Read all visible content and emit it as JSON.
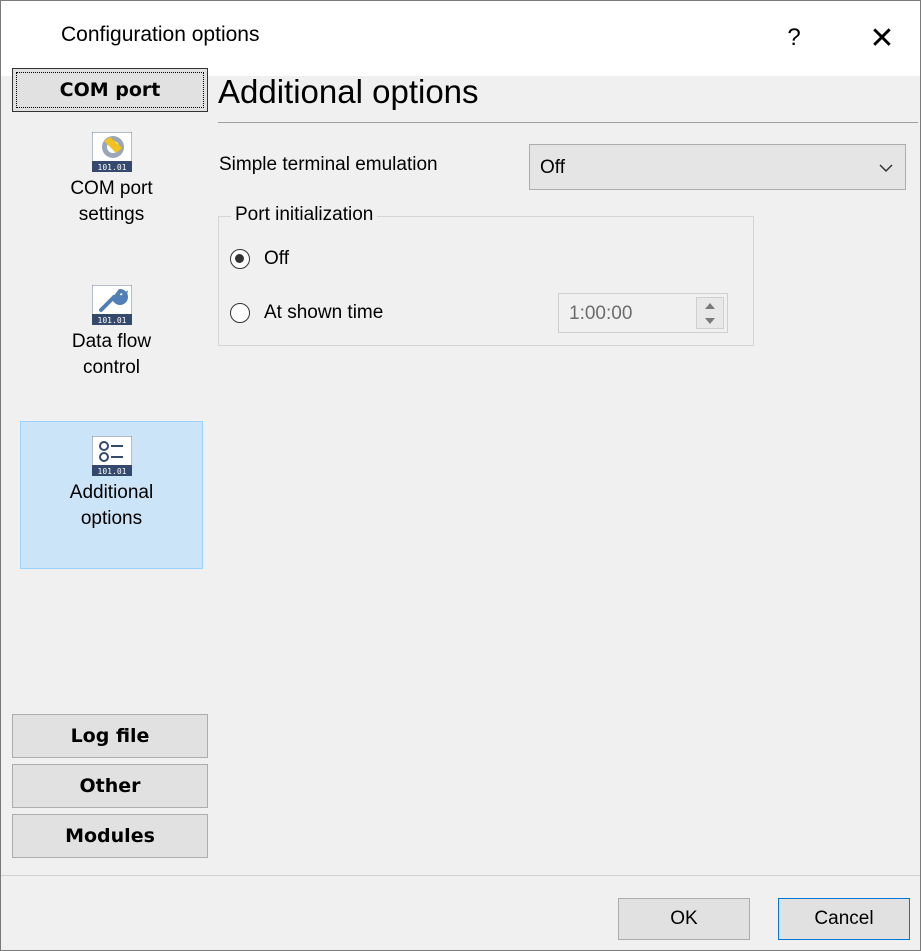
{
  "window": {
    "title": "Configuration options",
    "help_label": "?",
    "close_label": "✕"
  },
  "sidebar": {
    "active_group": "COM port",
    "items": [
      {
        "label": "COM port settings",
        "line1": "COM port",
        "line2": "settings",
        "icon": "com-port-settings-icon"
      },
      {
        "label": "Data flow control",
        "line1": "Data flow",
        "line2": "control",
        "icon": "wrench-icon"
      },
      {
        "label": "Additional options",
        "line1": "Additional",
        "line2": "options",
        "icon": "options-list-icon",
        "selected": true
      }
    ],
    "groups": [
      "Log file",
      "Other",
      "Modules"
    ]
  },
  "main": {
    "title": "Additional options",
    "terminal_emulation": {
      "label": "Simple terminal emulation",
      "value": "Off"
    },
    "port_init": {
      "legend": "Port initialization",
      "option_off": "Off",
      "option_time": "At shown time",
      "selected": "Off",
      "time_value": "1:00:00"
    }
  },
  "footer": {
    "ok_label": "OK",
    "cancel_label": "Cancel"
  },
  "colors": {
    "selection": "#cce4f7",
    "selection_border": "#99d1ff",
    "focus": "#0078d7"
  }
}
